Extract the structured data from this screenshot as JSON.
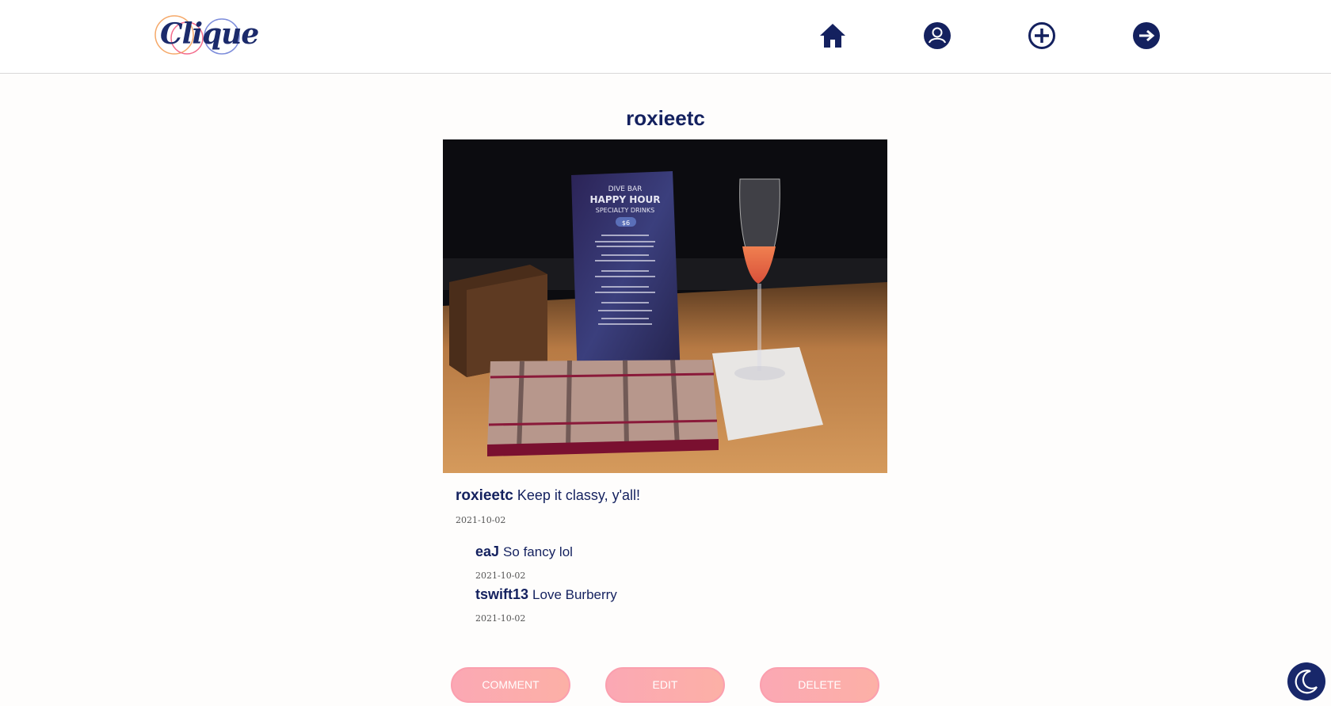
{
  "app": {
    "logo_text": "Clique"
  },
  "nav": {
    "icons": [
      "home-icon",
      "profile-icon",
      "add-post-icon",
      "logout-icon"
    ]
  },
  "post": {
    "author": "roxieetc",
    "caption_author": "roxieetc",
    "caption": "Keep it classy, y'all!",
    "date": "2021-10-02",
    "image_alt": "Dive bar happy hour menu, champagne flute, plaid wallet on wooden bar",
    "image_menu_text": {
      "line1": "DIVE BAR",
      "line2": "HAPPY HOUR",
      "line3": "SPECIALTY DRINKS",
      "price": "$6"
    }
  },
  "comments": [
    {
      "author": "eaJ",
      "text": "So fancy lol",
      "date": "2021-10-02"
    },
    {
      "author": "tswift13",
      "text": "Love Burberry",
      "date": "2021-10-02"
    }
  ],
  "actions": {
    "comment_label": "COMMENT",
    "edit_label": "EDIT",
    "delete_label": "DELETE"
  },
  "colors": {
    "brand_navy": "#14215f",
    "button_pink": "#fba8b4",
    "background": "#fefdfc"
  }
}
